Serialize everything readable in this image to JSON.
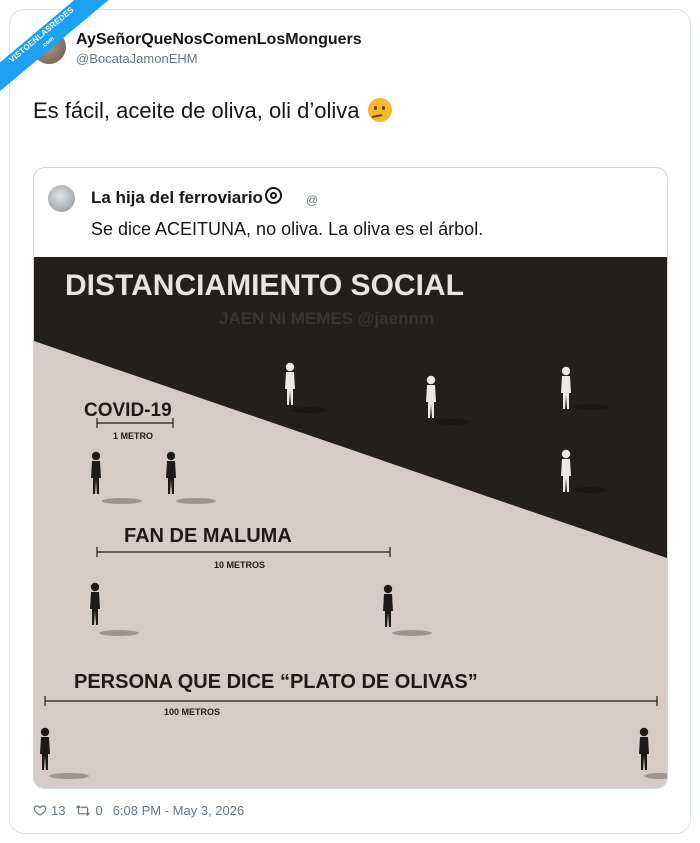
{
  "branding": {
    "ribbon_text": "VISTOENLASREDES",
    "ribbon_sub": ".com",
    "accent": "#1da1f2"
  },
  "tweet": {
    "author_name": "AySeñorQueNosComenLosMonguers",
    "author_handle": "@BocataJamonEHM",
    "text": "Es fácil, aceite de oliva, oli d’oliva",
    "emoji": "thinking-face-icon"
  },
  "quoted": {
    "author_name": "La hija del ferroviario",
    "author_handle": "@",
    "text": "Se dice ACEITUNA, no oliva. La oliva es el árbol."
  },
  "meme": {
    "title": "DISTANCIAMIENTO SOCIAL",
    "watermark": "JAEN NI MEMES @jaennm",
    "sections": [
      {
        "label": "COVID-19",
        "distance": "1 METRO"
      },
      {
        "label": "FAN DE MALUMA",
        "distance": "10 METROS"
      },
      {
        "label": "PERSONA QUE DICE “PLATO DE OLIVAS”",
        "distance": "100 METROS"
      }
    ],
    "colors": {
      "dark": "#231f1c",
      "light": "#d5ccc8"
    }
  },
  "footer": {
    "likes": "13",
    "retweets": "0",
    "timestamp": "6:08 PM - May 3, 2026"
  }
}
